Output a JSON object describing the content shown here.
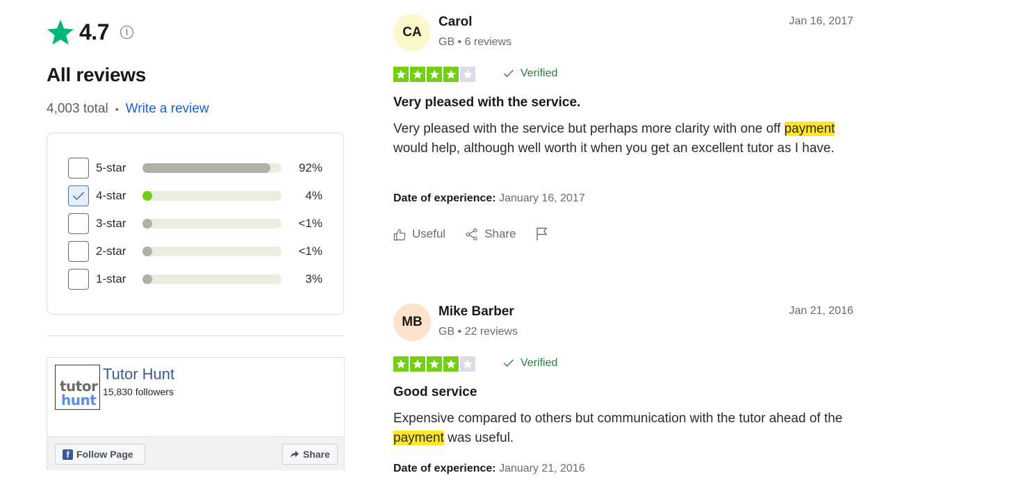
{
  "summary": {
    "rating": "4.7",
    "heading": "All reviews",
    "total": "4,003 total",
    "separator": "•",
    "write_review": "Write a review",
    "brand_color": "#00b67a"
  },
  "filters": [
    {
      "label": "5-star",
      "percent": "92%",
      "fill_fraction": 0.92,
      "checked": false
    },
    {
      "label": "4-star",
      "percent": "4%",
      "fill_fraction": 0.04,
      "checked": true
    },
    {
      "label": "3-star",
      "percent": "<1%",
      "fill_fraction": 0.01,
      "checked": false
    },
    {
      "label": "2-star",
      "percent": "<1%",
      "fill_fraction": 0.01,
      "checked": false
    },
    {
      "label": "1-star",
      "percent": "3%",
      "fill_fraction": 0.03,
      "checked": false
    }
  ],
  "facebook": {
    "logo_line1": "tutor",
    "logo_line2": "hunt",
    "page_name": "Tutor Hunt",
    "followers": "15,830 followers",
    "follow_label": "Follow Page",
    "share_label": "Share"
  },
  "reviews": [
    {
      "initials": "CA",
      "avatar_color": "#fdf8cc",
      "name": "Carol",
      "meta": "GB • 6 reviews",
      "date": "Jan 16, 2017",
      "stars": 4,
      "verified": "Verified",
      "title": "Very pleased with the service.",
      "body_before": "Very pleased with the service but perhaps more clarity with one off ",
      "highlight": "payment",
      "body_after": " would help, although well worth it when you get an excellent tutor as I have.",
      "exp_label": "Date of experience:",
      "exp_date": "January 16, 2017",
      "useful": "Useful",
      "share": "Share"
    },
    {
      "initials": "MB",
      "avatar_color": "#fde3cb",
      "name": "Mike Barber",
      "meta": "GB • 22 reviews",
      "date": "Jan 21, 2016",
      "stars": 4,
      "verified": "Verified",
      "title": "Good service",
      "body_before": "Expensive compared to others but communication with the tutor ahead of the ",
      "highlight": "payment",
      "body_after": " was useful.",
      "exp_label": "Date of experience:",
      "exp_date": "January 21, 2016"
    }
  ]
}
